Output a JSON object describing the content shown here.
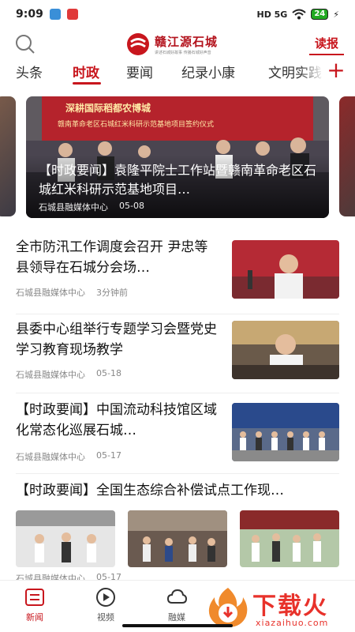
{
  "status_bar": {
    "time": "9:09",
    "network": "HD 5G",
    "battery": "24"
  },
  "header": {
    "logo_name": "赣江源石城",
    "logo_slogan": "讲述石城好故事 传播石城好声音",
    "read_paper": "读报"
  },
  "tabs": [
    {
      "label": "头条"
    },
    {
      "label": "时政"
    },
    {
      "label": "要闻"
    },
    {
      "label": "纪录小康"
    },
    {
      "label": "文明实践"
    }
  ],
  "banner": {
    "title": "【时政要闻】袁隆平院士工作站暨赣南革命老区石城红米科研示范基地项目…",
    "source": "石城县融媒体中心",
    "date": "05-08",
    "banner_text_1": "深耕国际稻都农博城",
    "banner_text_2": "赣南革命老区石城红米科研示范基地项目签约仪式"
  },
  "articles": [
    {
      "title": "全市防汛工作调度会召开 尹忠等县领导在石城分会场…",
      "source": "石城县融媒体中心",
      "date": "3分钟前"
    },
    {
      "title": "县委中心组举行专题学习会暨党史学习教育现场教学",
      "source": "石城县融媒体中心",
      "date": "05-18"
    },
    {
      "title": "【时政要闻】中国流动科技馆区域化常态化巡展石城…",
      "source": "石城县融媒体中心",
      "date": "05-17"
    }
  ],
  "multi_article": {
    "title": "【时政要闻】全国生态综合补偿试点工作现…",
    "source": "石城县融媒体中心",
    "date": "05-17"
  },
  "bottom_nav": [
    {
      "label": "新闻"
    },
    {
      "label": "视频"
    },
    {
      "label": "融媒"
    }
  ],
  "watermark": {
    "name": "下载火",
    "url": "xiazaihuo.com"
  },
  "colors": {
    "accent": "#c8161d",
    "watermark": "#e8322b"
  }
}
